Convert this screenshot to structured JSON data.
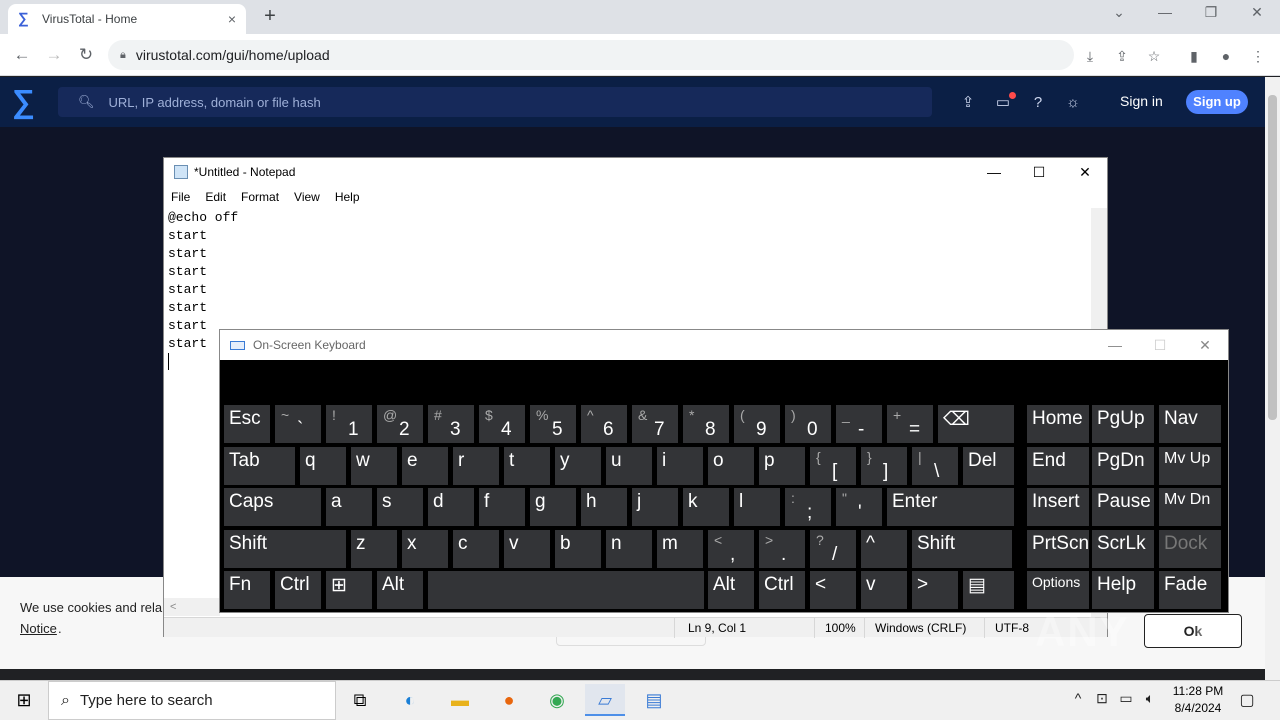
{
  "browser": {
    "tab_title": "VirusTotal - Home",
    "tab_close": "×",
    "new_tab": "+",
    "url": "virustotal.com/gui/home/upload",
    "window_controls": [
      "⌄",
      "—",
      "❐",
      "✕"
    ]
  },
  "vt": {
    "search_placeholder": "URL, IP address, domain or file hash",
    "sign_in": "Sign in",
    "sign_up": "Sign up",
    "cookie_text": "We use cookies and rela",
    "cookie_link": "Notice",
    "cookie_link_suffix": ".",
    "cookie_ok": "Ok"
  },
  "notepad": {
    "title": "*Untitled - Notepad",
    "menu": [
      "File",
      "Edit",
      "Format",
      "View",
      "Help"
    ],
    "content": "@echo off\nstart\nstart\nstart\nstart\nstart\nstart\nstart",
    "status": {
      "position": "Ln 9, Col 1",
      "zoom": "100%",
      "line_ending": "Windows (CRLF)",
      "encoding": "UTF-8"
    }
  },
  "osk": {
    "title": "On-Screen Keyboard",
    "rows": [
      [
        {
          "main": "Esc"
        },
        {
          "sh": "~",
          "mn": "`"
        },
        {
          "sh": "!",
          "mn": "1"
        },
        {
          "sh": "@",
          "mn": "2"
        },
        {
          "sh": "#",
          "mn": "3"
        },
        {
          "sh": "$",
          "mn": "4"
        },
        {
          "sh": "%",
          "mn": "5"
        },
        {
          "sh": "^",
          "mn": "6"
        },
        {
          "sh": "&",
          "mn": "7"
        },
        {
          "sh": "*",
          "mn": "8"
        },
        {
          "sh": "(",
          "mn": "9"
        },
        {
          "sh": ")",
          "mn": "0"
        },
        {
          "sh": "_",
          "mn": "-"
        },
        {
          "sh": "+",
          "mn": "="
        },
        {
          "main": "⌫"
        },
        {
          "main": "Home"
        },
        {
          "main": "PgUp"
        },
        {
          "main": "Nav"
        }
      ],
      [
        {
          "main": "Tab"
        },
        {
          "main": "q"
        },
        {
          "main": "w"
        },
        {
          "main": "e"
        },
        {
          "main": "r"
        },
        {
          "main": "t"
        },
        {
          "main": "y"
        },
        {
          "main": "u"
        },
        {
          "main": "i"
        },
        {
          "main": "o"
        },
        {
          "main": "p"
        },
        {
          "sh": "{",
          "mn": "["
        },
        {
          "sh": "}",
          "mn": "]"
        },
        {
          "sh": "|",
          "mn": "\\"
        },
        {
          "main": "Del"
        },
        {
          "main": "End"
        },
        {
          "main": "PgDn"
        },
        {
          "main": "Mv Up"
        }
      ],
      [
        {
          "main": "Caps"
        },
        {
          "main": "a"
        },
        {
          "main": "s"
        },
        {
          "main": "d"
        },
        {
          "main": "f"
        },
        {
          "main": "g"
        },
        {
          "main": "h"
        },
        {
          "main": "j"
        },
        {
          "main": "k"
        },
        {
          "main": "l"
        },
        {
          "sh": ":",
          "mn": ";"
        },
        {
          "sh": "\"",
          "mn": "'"
        },
        {
          "main": "Enter"
        },
        {
          "main": "Insert"
        },
        {
          "main": "Pause"
        },
        {
          "main": "Mv Dn"
        }
      ],
      [
        {
          "main": "Shift"
        },
        {
          "main": "z"
        },
        {
          "main": "x"
        },
        {
          "main": "c"
        },
        {
          "main": "v"
        },
        {
          "main": "b"
        },
        {
          "main": "n"
        },
        {
          "main": "m"
        },
        {
          "sh": "<",
          "mn": ","
        },
        {
          "sh": ">",
          "mn": "."
        },
        {
          "sh": "?",
          "mn": "/"
        },
        {
          "main": "^"
        },
        {
          "main": "Shift"
        },
        {
          "main": "PrtScn"
        },
        {
          "main": "ScrLk"
        },
        {
          "main": "Dock"
        }
      ],
      [
        {
          "main": "Fn"
        },
        {
          "main": "Ctrl"
        },
        {
          "main": "⊞"
        },
        {
          "main": "Alt"
        },
        {
          "main": ""
        },
        {
          "main": "Alt"
        },
        {
          "main": "Ctrl"
        },
        {
          "main": "<"
        },
        {
          "main": "v"
        },
        {
          "main": ">"
        },
        {
          "main": "▤"
        },
        {
          "main": "Options"
        },
        {
          "main": "Help"
        },
        {
          "main": "Fade"
        }
      ]
    ]
  },
  "taskbar": {
    "search_placeholder": "Type here to search",
    "time": "11:28 PM",
    "date": "8/4/2024"
  },
  "watermark": "ANY RUN"
}
